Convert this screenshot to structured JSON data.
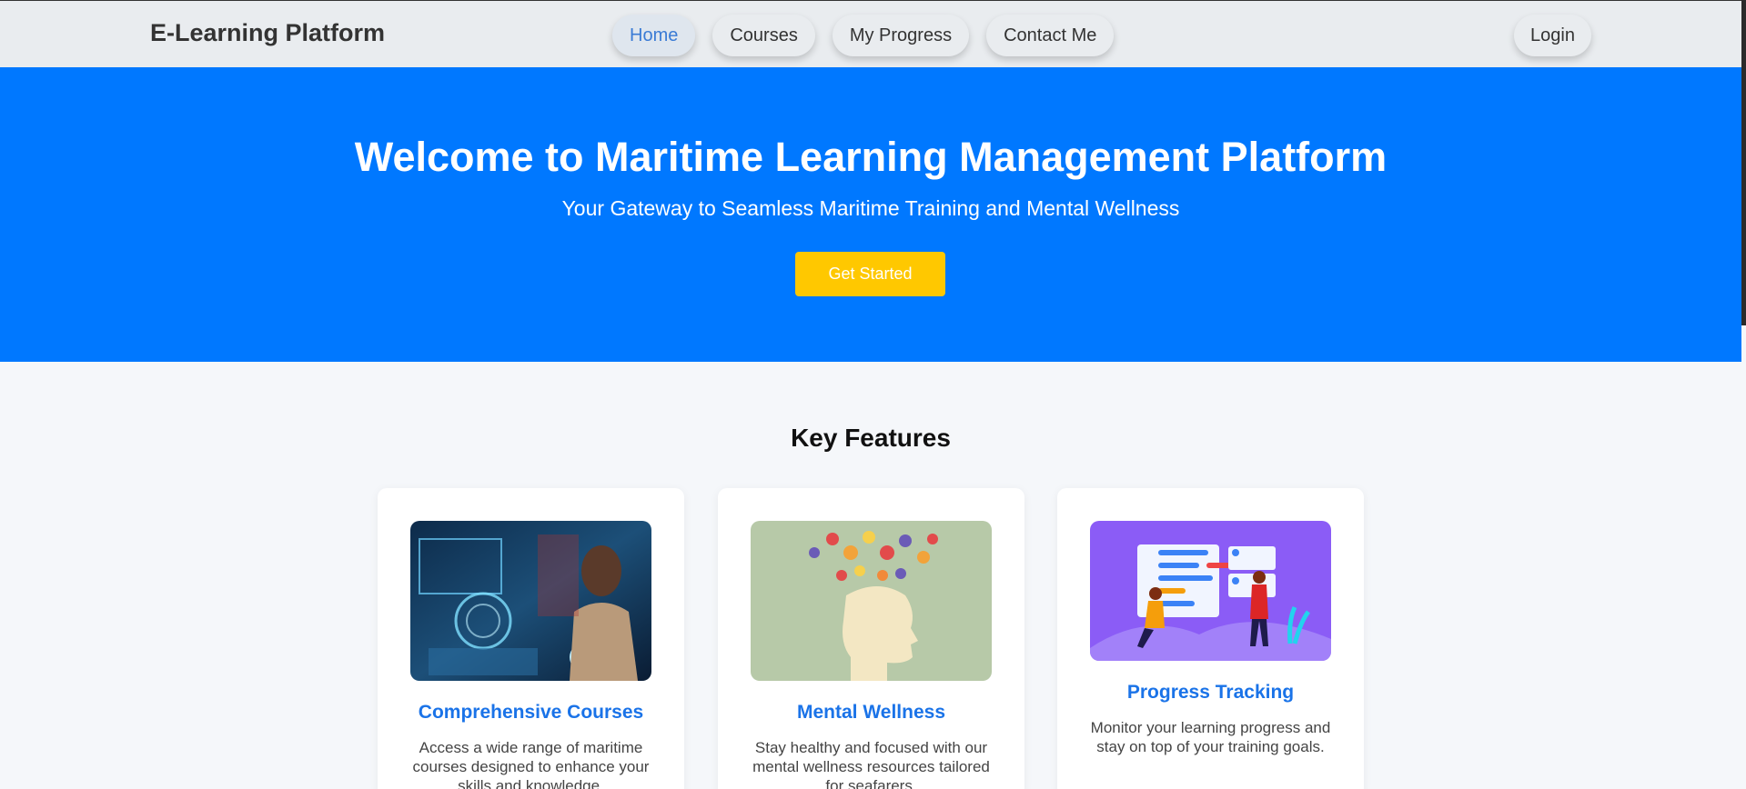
{
  "nav": {
    "brand": "E-Learning Platform",
    "links": [
      "Home",
      "Courses",
      "My Progress",
      "Contact Me"
    ],
    "active": "Home",
    "login": "Login"
  },
  "hero": {
    "title": "Welcome to Maritime Learning Management Platform",
    "subtitle": "Your Gateway to Seamless Maritime Training and Mental Wellness",
    "cta": "Get Started"
  },
  "features": {
    "title": "Key Features",
    "cards": [
      {
        "title": "Comprehensive Courses",
        "text": "Access a wide range of maritime courses designed to enhance your skills and knowledge.",
        "image": "woman-tech-hud-image"
      },
      {
        "title": "Mental Wellness",
        "text": "Stay healthy and focused with our mental wellness resources tailored for seafarers.",
        "image": "head-with-flowers-image"
      },
      {
        "title": "Progress Tracking",
        "text": "Monitor your learning progress and stay on top of your training goals.",
        "image": "progress-dashboard-illustration"
      }
    ]
  },
  "colors": {
    "hero_bg": "#0078ff",
    "cta_bg": "#ffc800",
    "accent": "#1a73e8",
    "nav_bg": "#e9ecef"
  }
}
